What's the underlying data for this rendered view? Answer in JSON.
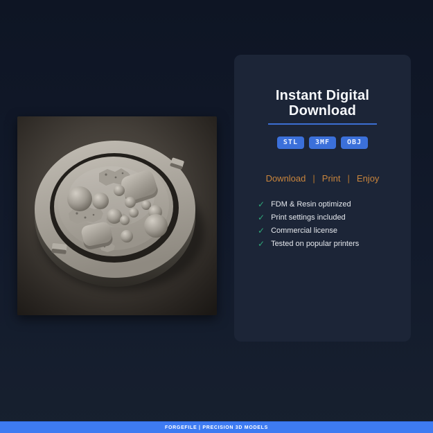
{
  "panel": {
    "title_line1": "Instant Digital",
    "title_line2": "Download",
    "formats": [
      "STL",
      "3MF",
      "OBJ"
    ],
    "tagline": {
      "items": [
        "Download",
        "Print",
        "Enjoy"
      ],
      "separator": "|"
    },
    "check_glyph": "✓",
    "features": [
      "FDM & Resin optimized",
      "Print settings included",
      "Commercial license",
      "Tested on popular printers"
    ]
  },
  "footer": {
    "text": "FORGEFILE | PRECISION 3D MODELS"
  },
  "product_image": {
    "description": "Gray clay-style 3D render of a round rimmed dish model filled with spheres, rounded cubes and rocky debris"
  },
  "colors": {
    "accent_blue": "#3b70da",
    "underline_blue": "#3c6fd3",
    "accent_orange": "#c9853c",
    "check_green": "#2fa87a",
    "footer_blue": "#3e7bf2",
    "panel_bg": "#1c2537",
    "page_bg": "#121a2b"
  }
}
